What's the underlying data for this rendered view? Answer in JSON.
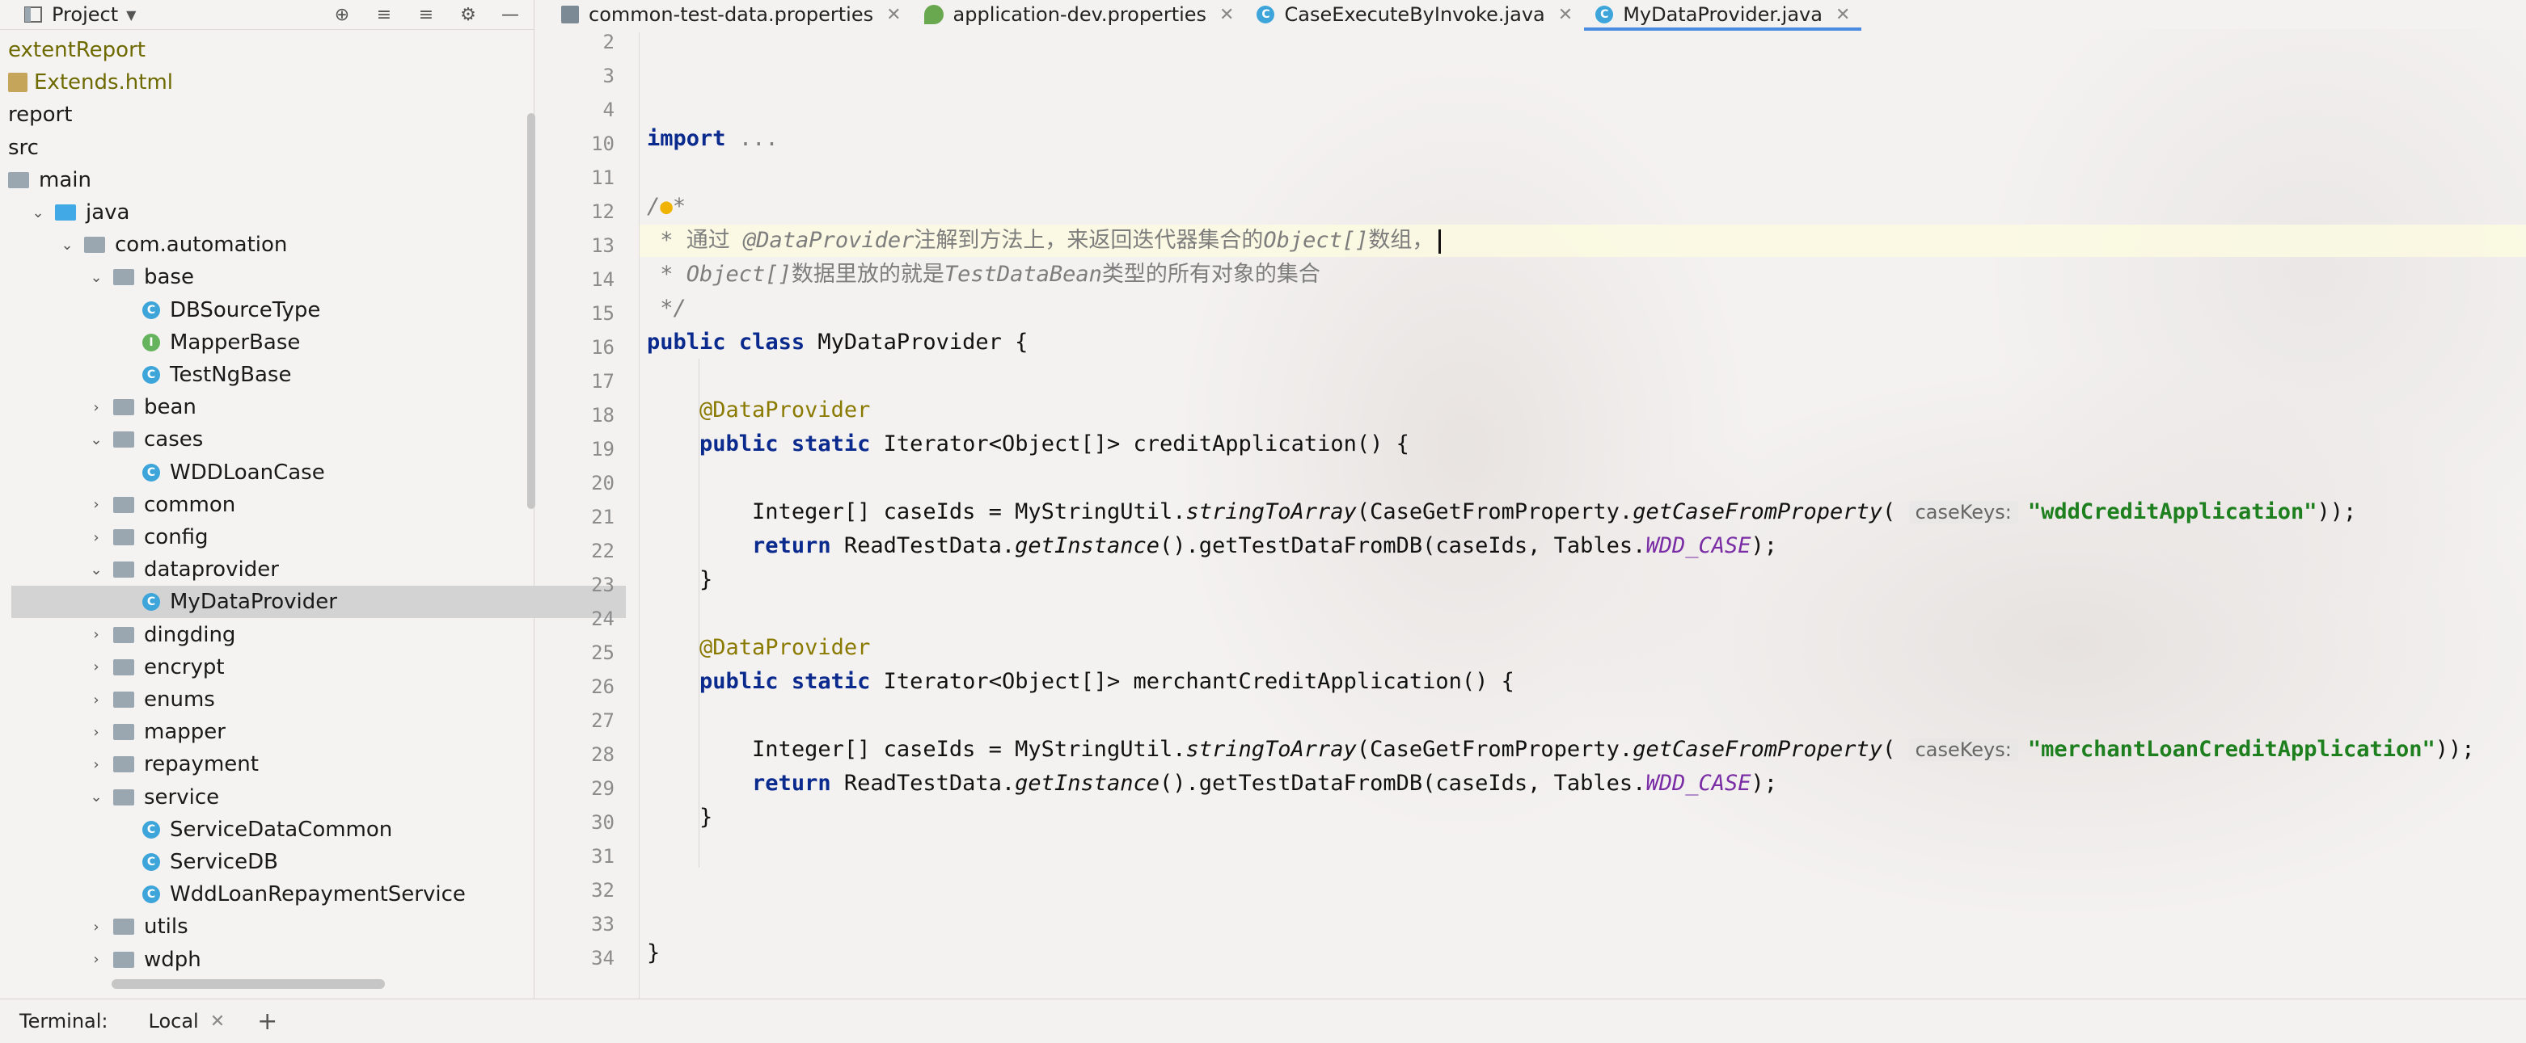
{
  "project_panel": {
    "title": "Project",
    "tree": [
      {
        "label": "extentReport",
        "indent": 0,
        "kind": "text-olive"
      },
      {
        "label": "Extends.html",
        "indent": 0,
        "kind": "html"
      },
      {
        "label": "report",
        "indent": 0,
        "kind": "text"
      },
      {
        "label": "src",
        "indent": 0,
        "kind": "text"
      },
      {
        "label": "main",
        "indent": 0,
        "kind": "folder"
      },
      {
        "label": "java",
        "indent": 1,
        "kind": "folder-blue",
        "arrow": "open"
      },
      {
        "label": "com.automation",
        "indent": 2,
        "kind": "folder",
        "arrow": "open"
      },
      {
        "label": "base",
        "indent": 3,
        "kind": "folder",
        "arrow": "open"
      },
      {
        "label": "DBSourceType",
        "indent": 4,
        "kind": "class"
      },
      {
        "label": "MapperBase",
        "indent": 4,
        "kind": "interface"
      },
      {
        "label": "TestNgBase",
        "indent": 4,
        "kind": "class"
      },
      {
        "label": "bean",
        "indent": 3,
        "kind": "folder",
        "arrow": "closed"
      },
      {
        "label": "cases",
        "indent": 3,
        "kind": "folder",
        "arrow": "open"
      },
      {
        "label": "WDDLoanCase",
        "indent": 4,
        "kind": "class"
      },
      {
        "label": "common",
        "indent": 3,
        "kind": "folder",
        "arrow": "closed"
      },
      {
        "label": "config",
        "indent": 3,
        "kind": "folder",
        "arrow": "closed"
      },
      {
        "label": "dataprovider",
        "indent": 3,
        "kind": "folder",
        "arrow": "open"
      },
      {
        "label": "MyDataProvider",
        "indent": 4,
        "kind": "class",
        "selected": true
      },
      {
        "label": "dingding",
        "indent": 3,
        "kind": "folder",
        "arrow": "closed"
      },
      {
        "label": "encrypt",
        "indent": 3,
        "kind": "folder",
        "arrow": "closed"
      },
      {
        "label": "enums",
        "indent": 3,
        "kind": "folder",
        "arrow": "closed"
      },
      {
        "label": "mapper",
        "indent": 3,
        "kind": "folder",
        "arrow": "closed"
      },
      {
        "label": "repayment",
        "indent": 3,
        "kind": "folder",
        "arrow": "closed"
      },
      {
        "label": "service",
        "indent": 3,
        "kind": "folder",
        "arrow": "open"
      },
      {
        "label": "ServiceDataCommon",
        "indent": 4,
        "kind": "class"
      },
      {
        "label": "ServiceDB",
        "indent": 4,
        "kind": "class"
      },
      {
        "label": "WddLoanRepaymentService",
        "indent": 4,
        "kind": "class"
      },
      {
        "label": "utils",
        "indent": 3,
        "kind": "folder",
        "arrow": "closed"
      },
      {
        "label": "wdph",
        "indent": 3,
        "kind": "folder",
        "arrow": "closed"
      }
    ]
  },
  "tabs": [
    {
      "label": "common-test-data.properties",
      "icon": "properties-file-icon",
      "active": false
    },
    {
      "label": "application-dev.properties",
      "icon": "spring-leaf-icon",
      "active": false
    },
    {
      "label": "CaseExecuteByInvoke.java",
      "icon": "java-class-icon",
      "active": false
    },
    {
      "label": "MyDataProvider.java",
      "icon": "java-class-icon",
      "active": true
    }
  ],
  "editor": {
    "line_numbers": [
      "2",
      "3",
      "4",
      "10",
      "11",
      "12",
      "13",
      "14",
      "15",
      "16",
      "17",
      "18",
      "19",
      "20",
      "21",
      "22",
      "23",
      "24",
      "25",
      "26",
      "27",
      "28",
      "29",
      "30",
      "31",
      "32",
      "33",
      "34"
    ],
    "code": {
      "import_kw": "import",
      "import_dots": "...",
      "comment_open": "/",
      "comment_star": "*",
      "c1_a": " * 通过 ",
      "c1_b": "@DataProvider",
      "c1_c": "注解到方法上，来返回迭代器集合的",
      "c1_d": "Object[]",
      "c1_e": "数组，",
      "c2_a": " * ",
      "c2_b": "Object[]",
      "c2_c": "数据里放的就是",
      "c2_d": "TestDataBean",
      "c2_e": "类型的所有对象的集合",
      "c3": " */",
      "class_public": "public",
      "class_kw": "class",
      "class_name": " MyDataProvider {",
      "annotation": "@DataProvider",
      "m_public": "public",
      "m_static": "static",
      "m1_sig": " Iterator<Object[]> creditApplication() {",
      "m2_sig": " Iterator<Object[]> merchantCreditApplication() {",
      "arr_decl": "Integer[] caseIds = MyStringUtil.",
      "string_to_array": "stringToArray",
      "paren_case": "(CaseGetFromProperty.",
      "get_case": "getCaseFromProperty",
      "open_paren": "(",
      "hint_label": "caseKeys:",
      "str1": "\"wddCreditApplication\"",
      "str2": "\"merchantLoanCreditApplication\"",
      "close_parens": "));",
      "return_kw": "return",
      "ret_a": " ReadTestData.",
      "get_instance": "getInstance",
      "ret_b": "().getTestDataFromDB(caseIds, Tables.",
      "wdd_case": "WDD_CASE",
      "ret_end": ");",
      "close_brace": "}"
    }
  },
  "bottom_bar": {
    "terminal_label": "Terminal:",
    "local_tab": "Local",
    "plus": "+"
  },
  "colors": {
    "keyword": "#0a2a8e",
    "string": "#1d7f1d",
    "annotation": "#8a7a00",
    "comment": "#7d7d7d",
    "constant": "#7a2ca5",
    "active_tab_underline": "#4a8de0",
    "class_icon": "#3da5d9",
    "interface_icon": "#66b35d"
  }
}
